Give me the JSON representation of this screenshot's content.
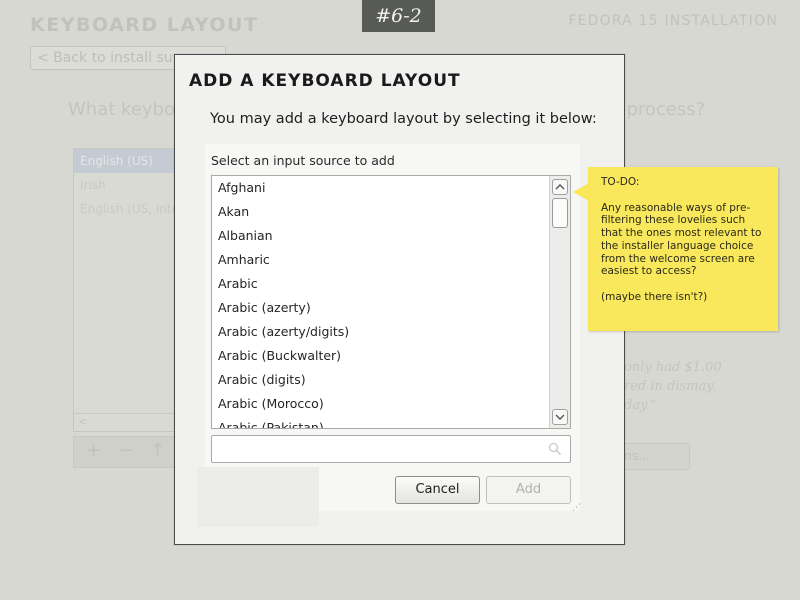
{
  "background": {
    "title": "KEYBOARD LAYOUT",
    "product": "FEDORA 15 INSTALLATION",
    "badge": "#6-2",
    "back_button": "< Back to install su",
    "question": "What keybo",
    "question_tail": "process?",
    "layouts": [
      "English (US)",
      "Irish",
      "English (US, inte"
    ],
    "scroll_left": "<",
    "toolbar": {
      "add": "+",
      "remove": "−",
      "up": "↑"
    },
    "quote": [
      "only had $1.00",
      "red in dismay.",
      "day.\""
    ],
    "options_button": "ons..."
  },
  "dialog": {
    "title": "ADD A KEYBOARD LAYOUT",
    "subtitle": "You may add a keyboard layout by selecting it below:",
    "list_caption": "Select an input source to add",
    "items": [
      "Afghani",
      "Akan",
      "Albanian",
      "Amharic",
      "Arabic",
      "Arabic (azerty)",
      "Arabic (azerty/digits)",
      "Arabic (Buckwalter)",
      "Arabic (digits)",
      "Arabic (Morocco)",
      "Arabic (Pakistan)"
    ],
    "search": {
      "value": "",
      "placeholder": ""
    },
    "cancel_label": "Cancel",
    "add_label": "Add"
  },
  "note": {
    "heading": "TO-DO:",
    "body": "Any reasonable ways of pre-filtering these lovelies such that the ones most relevant to the installer language choice from the welcome screen are easiest to access?",
    "aside": "(maybe there isn't?)"
  },
  "colors": {
    "badge_bg": "#585a56",
    "note_bg": "#f9e85c",
    "dialog_border": "#4b4b4b",
    "selected_row": "#c4cbd2"
  },
  "icons": {
    "scroll_up": "chevron-up-icon",
    "scroll_down": "chevron-down-icon",
    "search": "search-icon"
  }
}
